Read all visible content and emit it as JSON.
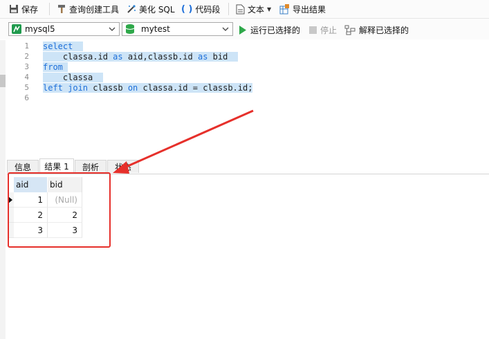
{
  "toolbar": {
    "save": "保存",
    "query_builder": "查询创建工具",
    "beautify": "美化 SQL",
    "snippet": "代码段",
    "text": "文本",
    "export": "导出结果"
  },
  "connection": {
    "server": "mysql5",
    "database": "mytest",
    "run_selected": "运行已选择的",
    "stop": "停止",
    "explain_selected": "解释已选择的"
  },
  "editor": {
    "line_numbers": [
      "1",
      "2",
      "3",
      "4",
      "5",
      "6"
    ],
    "lines": [
      {
        "segments": [
          {
            "t": "select",
            "c": "kw"
          },
          {
            "t": "  ",
            "c": "tx"
          }
        ]
      },
      {
        "segments": [
          {
            "t": "    classa.id ",
            "c": "tx"
          },
          {
            "t": "as",
            "c": "kw"
          },
          {
            "t": " aid,classb.id ",
            "c": "tx"
          },
          {
            "t": "as",
            "c": "kw"
          },
          {
            "t": " bid  ",
            "c": "tx"
          }
        ]
      },
      {
        "segments": [
          {
            "t": "from",
            "c": "kw"
          },
          {
            "t": " ",
            "c": "tx"
          }
        ]
      },
      {
        "segments": [
          {
            "t": "    classa  ",
            "c": "tx"
          }
        ]
      },
      {
        "segments": [
          {
            "t": "left join",
            "c": "kw"
          },
          {
            "t": " classb ",
            "c": "tx"
          },
          {
            "t": "on",
            "c": "kw"
          },
          {
            "t": " classa.id = classb.id;",
            "c": "tx"
          }
        ]
      },
      {
        "segments": []
      }
    ]
  },
  "tabs": [
    {
      "label": "信息",
      "active": false
    },
    {
      "label": "结果 1",
      "active": true
    },
    {
      "label": "剖析",
      "active": false
    },
    {
      "label": "状态",
      "active": false
    }
  ],
  "results": {
    "columns": [
      "aid",
      "bid"
    ],
    "rows": [
      [
        "1",
        "(Null)"
      ],
      [
        "2",
        "2"
      ],
      [
        "3",
        "3"
      ]
    ]
  },
  "colors": {
    "selection": "#cde4f7",
    "keyword": "#1e6fd9",
    "annotation": "#e6302b",
    "run_green": "#2ea84a"
  }
}
